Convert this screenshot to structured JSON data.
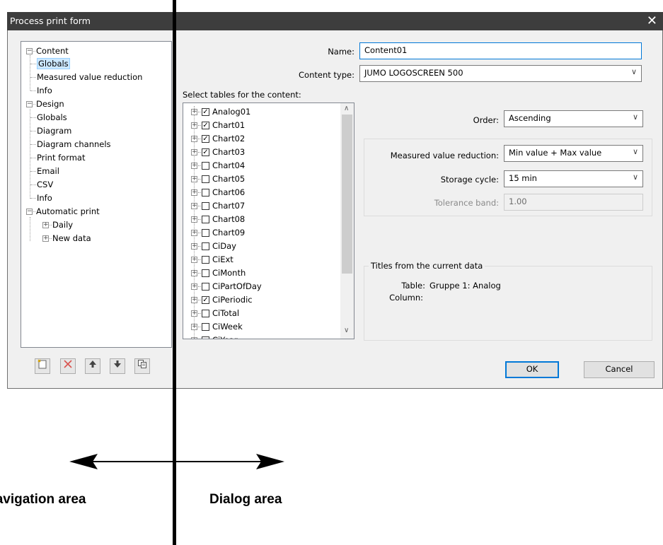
{
  "window": {
    "title": "Process print form",
    "close_glyph": "✕"
  },
  "tree": {
    "items": [
      {
        "label": "Content",
        "expander": "−"
      },
      {
        "label": "Globals"
      },
      {
        "label": "Measured value reduction"
      },
      {
        "label": "Info"
      },
      {
        "label": "Design",
        "expander": "−"
      },
      {
        "label": "Globals"
      },
      {
        "label": "Diagram"
      },
      {
        "label": "Diagram channels"
      },
      {
        "label": "Print format"
      },
      {
        "label": "Email"
      },
      {
        "label": "CSV"
      },
      {
        "label": "Info"
      },
      {
        "label": "Automatic print",
        "expander": "−"
      },
      {
        "label": "Daily",
        "expander": "+"
      },
      {
        "label": "New data",
        "expander": "+"
      }
    ],
    "selected": "Globals"
  },
  "toolbar": {
    "icons": [
      "new-icon",
      "delete-icon",
      "move-up-icon",
      "move-down-icon",
      "copy-icon"
    ]
  },
  "form": {
    "name_label": "Name:",
    "name_value": "Content01",
    "content_type_label": "Content type:",
    "content_type_value": "JUMO LOGOSCREEN 500",
    "select_tables_label": "Select tables for the content:",
    "order_label": "Order:",
    "order_value": "Ascending",
    "mvr_label": "Measured value reduction:",
    "mvr_value": "Min value + Max value",
    "storage_label": "Storage cycle:",
    "storage_value": "15 min",
    "tolerance_label": "Tolerance band:",
    "tolerance_value": "1.00"
  },
  "tables": [
    {
      "name": "Analog01",
      "checked": true
    },
    {
      "name": "Chart01",
      "checked": true
    },
    {
      "name": "Chart02",
      "checked": true
    },
    {
      "name": "Chart03",
      "checked": true
    },
    {
      "name": "Chart04",
      "checked": false
    },
    {
      "name": "Chart05",
      "checked": false
    },
    {
      "name": "Chart06",
      "checked": false
    },
    {
      "name": "Chart07",
      "checked": false
    },
    {
      "name": "Chart08",
      "checked": false
    },
    {
      "name": "Chart09",
      "checked": false
    },
    {
      "name": "CiDay",
      "checked": false
    },
    {
      "name": "CiExt",
      "checked": false
    },
    {
      "name": "CiMonth",
      "checked": false
    },
    {
      "name": "CiPartOfDay",
      "checked": false
    },
    {
      "name": "CiPeriodic",
      "checked": true
    },
    {
      "name": "CiTotal",
      "checked": false
    },
    {
      "name": "CiWeek",
      "checked": false
    },
    {
      "name": "CiYear",
      "checked": false
    }
  ],
  "titles_group": {
    "title": "Titles from the current data",
    "table_label": "Table:",
    "table_value": "Gruppe 1: Analog",
    "column_label": "Column:",
    "column_value": ""
  },
  "buttons": {
    "ok": "OK",
    "cancel": "Cancel"
  },
  "annotations": {
    "navigation_area": "Navigation area",
    "dialog_area": "Dialog area"
  },
  "colors": {
    "titlebar": "#3d3d3d",
    "accent": "#0078d7",
    "selection": "#cce8ff"
  }
}
